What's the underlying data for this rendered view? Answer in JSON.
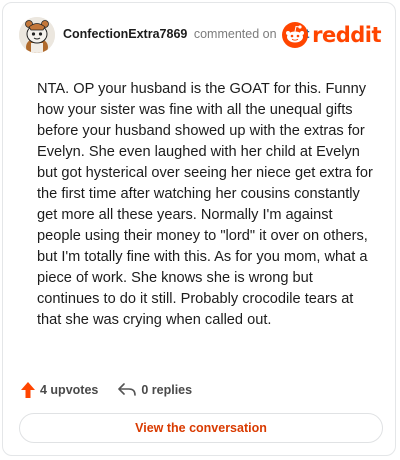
{
  "comment": {
    "username": "ConfectionExtra7869",
    "action_text": "commented on",
    "post_link": "post",
    "body": "NTA. OP your husband is the GOAT for this. Funny how your sister was fine with all the unequal gifts before your husband showed up with the extras for Evelyn. She even laughed with her child at Evelyn but got hysterical over seeing her niece get extra for the first time after watching her cousins constantly get more all these years. Normally I'm against people using their money to \"lord\" it over on others, but I'm totally fine with this. As for you mom, what a piece of work. She knows she is wrong but continues to do it still. Probably crocodile tears at that she was crying when called out."
  },
  "brand": {
    "logo_text": "reddit",
    "accent": "#ff4500"
  },
  "actions": {
    "upvotes_label": "4 upvotes",
    "replies_label": "0 replies",
    "upvote_color": "#ff4500"
  },
  "footer": {
    "view_button_label": "View the conversation",
    "link_color": "#d93a00"
  },
  "icons": {
    "avatar": "snoo-avatar-icon",
    "upvote": "upvote-arrow-icon",
    "reply": "reply-arrow-icon",
    "logo": "reddit-snoo-icon"
  }
}
